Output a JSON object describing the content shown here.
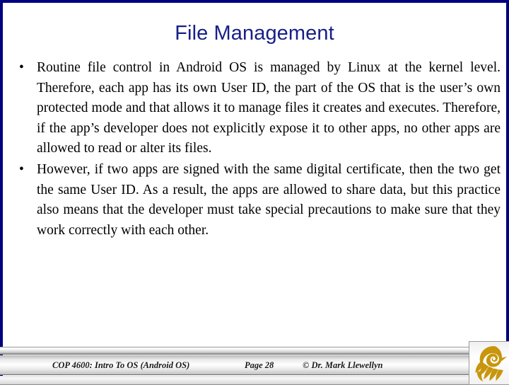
{
  "slide": {
    "title": "File Management",
    "title_color": "#171F87",
    "border_color": "#000080",
    "background_color": "#FFFFFF",
    "bullet_glyph": "•",
    "bullets": [
      "Routine file control in Android OS is managed by Linux at the kernel level.  Therefore, each app has its own User ID, the part of the OS that is the user’s own protected mode and that allows it to manage files it creates and executes.   Therefore, if the app’s developer does not explicitly expose it to other apps, no other apps are allowed to read or alter its files.",
      "However, if two apps are signed with the same digital certificate, then the two get the same User ID.   As a result, the apps are allowed to share data, but this practice also means that the developer must take special precautions to make sure that they work correctly with each other."
    ]
  },
  "footer": {
    "course": "COP 4600: Intro To OS  (Android OS)",
    "page": "Page 28",
    "copyright": "© Dr. Mark Llewellyn",
    "logo_name": "ucf-pegasus-logo",
    "logo_color": "#C8960C"
  }
}
